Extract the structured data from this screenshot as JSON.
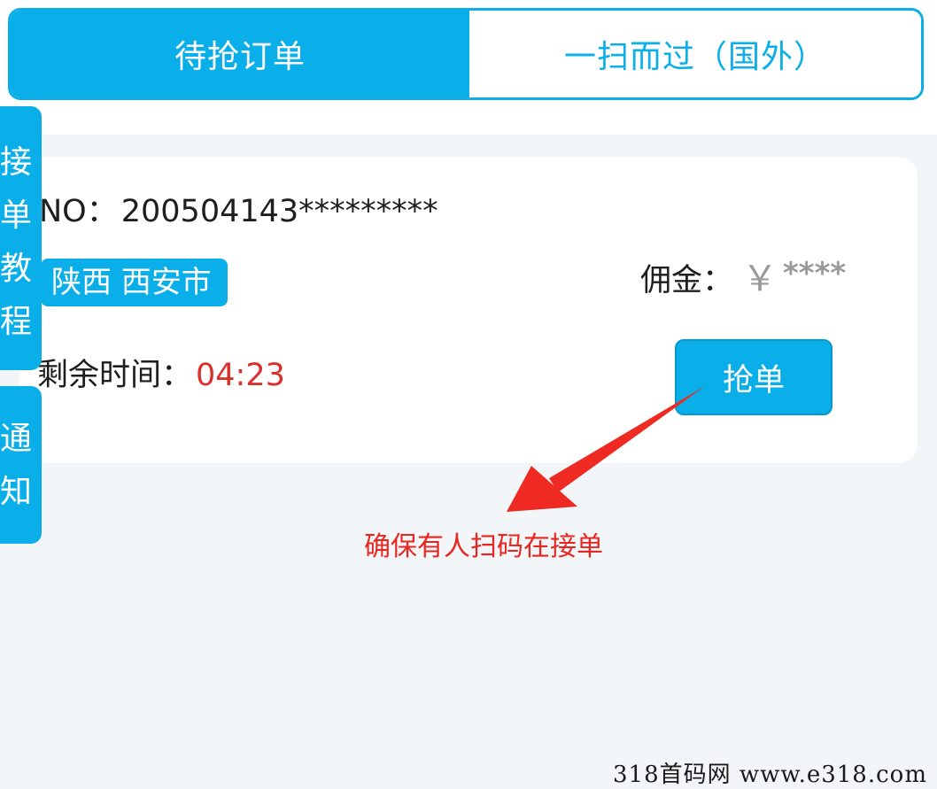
{
  "tabs": {
    "active": "待抢订单",
    "inactive": "一扫而过（国外）"
  },
  "side_tabs": {
    "tutorial": [
      "接",
      "单",
      "教",
      "程"
    ],
    "notice": [
      "通",
      "知"
    ]
  },
  "order": {
    "no_label": "NO",
    "no_colon": "：",
    "no_value": "200504143*********",
    "region": "陕西 西安市",
    "commission_label": "佣金：",
    "commission_currency": "￥",
    "commission_value": "****",
    "time_label": "剩余时间：",
    "time_value": "04:23",
    "grab_label": "抢单"
  },
  "annotation": {
    "text": "确保有人扫码在接单"
  },
  "watermark": "318首码网  www.e318.com",
  "colors": {
    "accent": "#0aaee8",
    "timer": "#d9302c",
    "annotation": "#e8261f"
  }
}
